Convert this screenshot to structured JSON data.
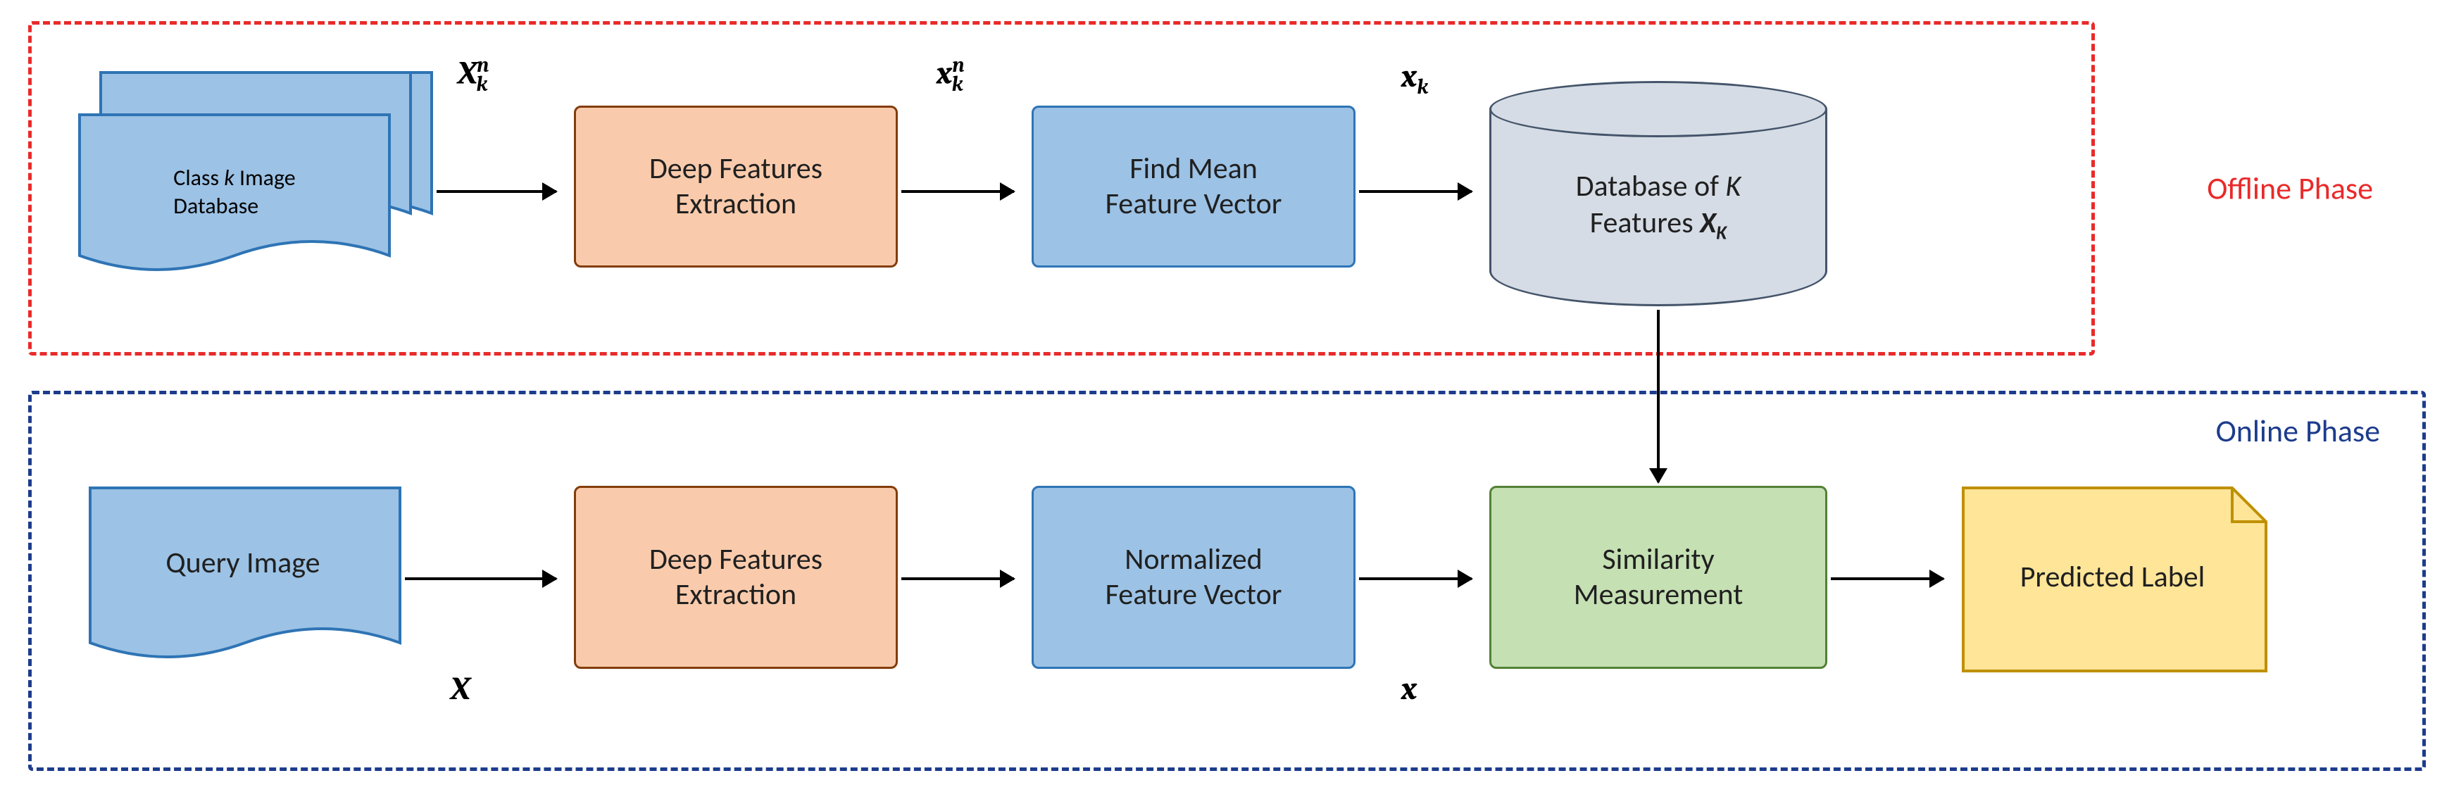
{
  "phases": {
    "offline_label": "Offline Phase",
    "online_label": "Online Phase"
  },
  "offline": {
    "class_db": "Class k Image\nDatabase",
    "deep_feat": "Deep Features\nExtraction",
    "find_mean": "Find Mean\nFeature Vector",
    "db_k": "Database of K\nFeatures X_K"
  },
  "online": {
    "query_img": "Query Image",
    "deep_feat": "Deep Features\nExtraction",
    "norm_feat": "Normalized\nFeature Vector",
    "sim_meas": "Similarity\nMeasurement",
    "pred_label": "Predicted Label"
  },
  "vars": {
    "Xkn_cap": "X_k^n",
    "xkn": "x_k^n",
    "xk": "x_k",
    "X_cap": "X",
    "x_low": "x"
  }
}
